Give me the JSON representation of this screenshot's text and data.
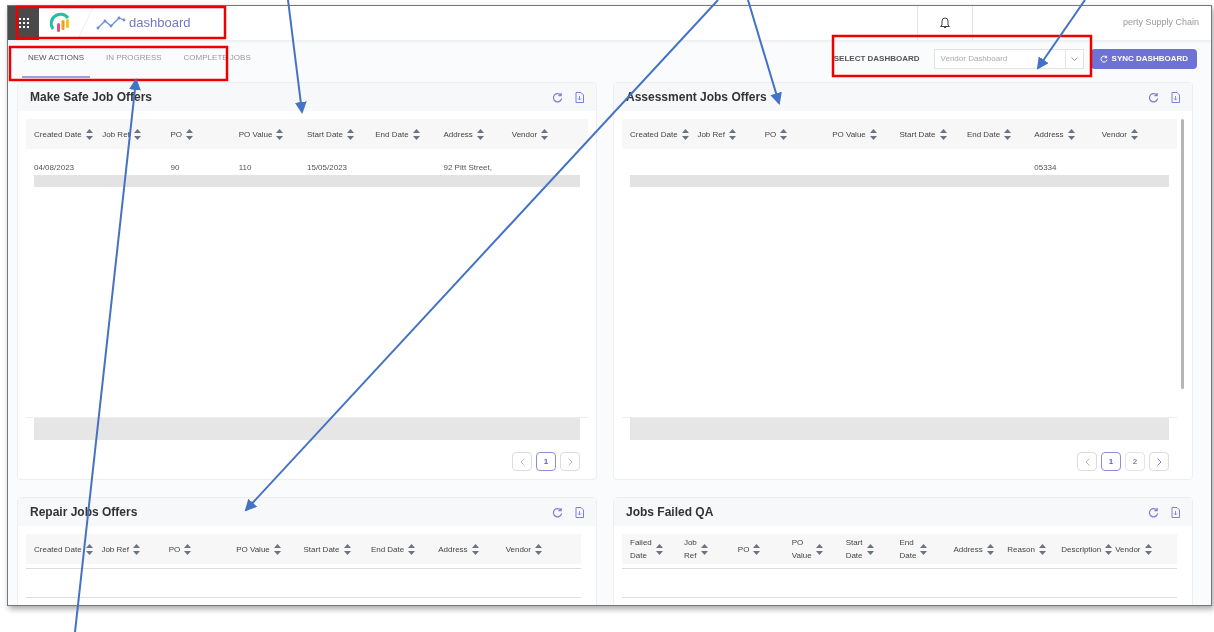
{
  "header": {
    "app_title": "dashboard",
    "org_text": "perty Supply Chain"
  },
  "tabs": [
    {
      "label": "NEW ACTIONS",
      "selected": true
    },
    {
      "label": "IN PROGRESS",
      "selected": false
    },
    {
      "label": "COMPLETE JOBS",
      "selected": false
    }
  ],
  "dashboard_select": {
    "label": "SELECT DASHBOARD",
    "value": "Vendor Dashboard"
  },
  "sync_button": "SYNC DASHBOARD",
  "panels": [
    {
      "title": "Make Safe Job Offers",
      "columns": [
        "Created Date",
        "Job Ref",
        "PO",
        "PO Value",
        "Start Date",
        "End Date",
        "Address",
        "Vendor"
      ],
      "rows": [
        [
          "04/08/2023",
          "",
          "90",
          "110",
          "15/05/2023",
          "",
          "92 Pitt Street,",
          ""
        ]
      ],
      "pagination": {
        "prev_enabled": false,
        "next_enabled": false,
        "pages": [
          {
            "label": "1",
            "selected": true
          }
        ]
      }
    },
    {
      "title": "Assessment Jobs Offers",
      "columns": [
        "Created Date",
        "Job Ref",
        "PO",
        "PO Value",
        "Start Date",
        "End Date",
        "Address",
        "Vendor"
      ],
      "rows": [
        [
          "",
          "",
          "",
          "",
          "",
          "",
          "05334",
          ""
        ]
      ],
      "pagination": {
        "prev_enabled": false,
        "next_enabled": true,
        "pages": [
          {
            "label": "1",
            "selected": true
          },
          {
            "label": "2",
            "selected": false
          }
        ]
      }
    },
    {
      "title": "Repair Jobs Offers",
      "columns": [
        "Created Date",
        "Job Ref",
        "PO",
        "PO Value",
        "Start Date",
        "End Date",
        "Address",
        "Vendor"
      ]
    },
    {
      "title": "Jobs Failed QA",
      "columns": [
        "Failed Date",
        "Job Ref",
        "PO",
        "PO Value",
        "Start Date",
        "End Date",
        "Address",
        "Reason",
        "Description",
        "Vendor"
      ]
    }
  ]
}
